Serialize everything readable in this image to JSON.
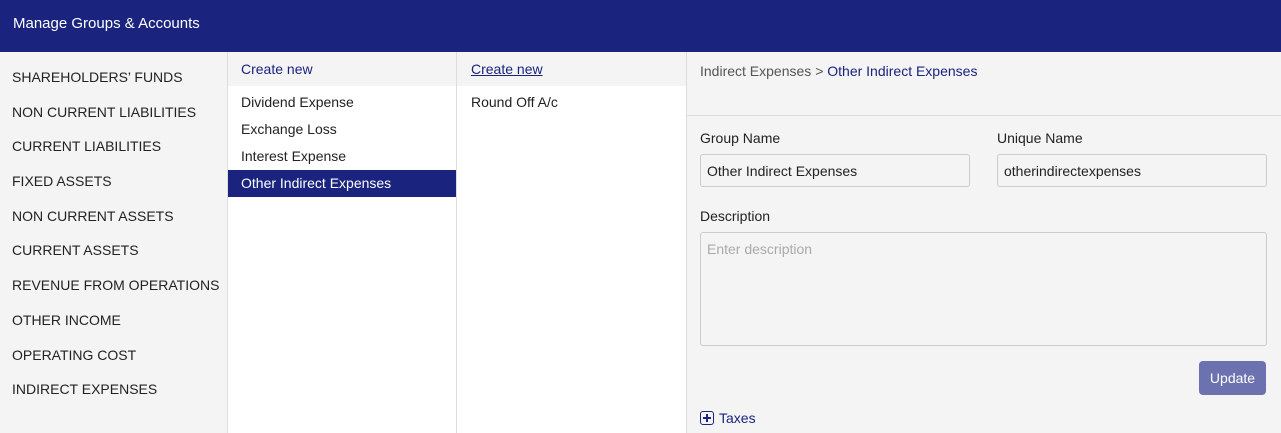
{
  "header": {
    "title": "Manage Groups & Accounts"
  },
  "groups": [
    "SHAREHOLDERS’ FUNDS",
    "NON CURRENT LIABILITIES",
    "CURRENT LIABILITIES",
    "FIXED ASSETS",
    "NON CURRENT ASSETS",
    "CURRENT ASSETS",
    "REVENUE FROM OPERATIONS",
    "OTHER INCOME",
    "OPERATING COST",
    "INDIRECT EXPENSES"
  ],
  "subgroups": {
    "create_label": "Create new",
    "items": [
      "Dividend Expense",
      "Exchange Loss",
      "Interest Expense",
      "Other Indirect Expenses"
    ],
    "selected": "Other Indirect Expenses"
  },
  "accounts": {
    "create_label": "Create new",
    "items": [
      "Round Off A/c"
    ]
  },
  "detail": {
    "breadcrumb": {
      "parent": "Indirect Expenses",
      "separator": ">",
      "current": "Other Indirect Expenses"
    },
    "group_name_label": "Group Name",
    "group_name_value": "Other Indirect Expenses",
    "unique_name_label": "Unique Name",
    "unique_name_value": "otherindirectexpenses",
    "description_label": "Description",
    "description_placeholder": "Enter description",
    "update_label": "Update",
    "taxes_label": "Taxes"
  }
}
